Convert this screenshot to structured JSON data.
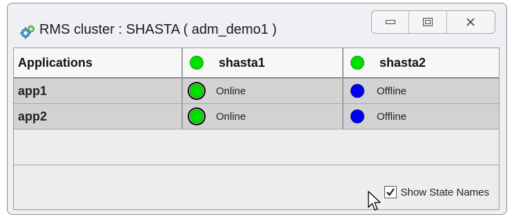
{
  "window": {
    "title": "RMS cluster : SHASTA ( adm_demo1 )",
    "icon": "cluster-gear-icon",
    "controls": [
      "minimize-icon",
      "restore-icon",
      "close-icon"
    ]
  },
  "table": {
    "header": {
      "applications": "Applications",
      "node1": "shasta1",
      "node2": "shasta2",
      "node1_status": "online",
      "node2_status": "online"
    },
    "rows": [
      {
        "app": "app1",
        "node1_state": "Online",
        "node2_state": "Offline"
      },
      {
        "app": "app2",
        "node1_state": "Online",
        "node2_state": "Offline"
      }
    ]
  },
  "footer": {
    "show_state_names_label": "Show State Names",
    "show_state_names_checked": true
  },
  "colors": {
    "online": "#00e000",
    "offline": "#0000ee"
  }
}
